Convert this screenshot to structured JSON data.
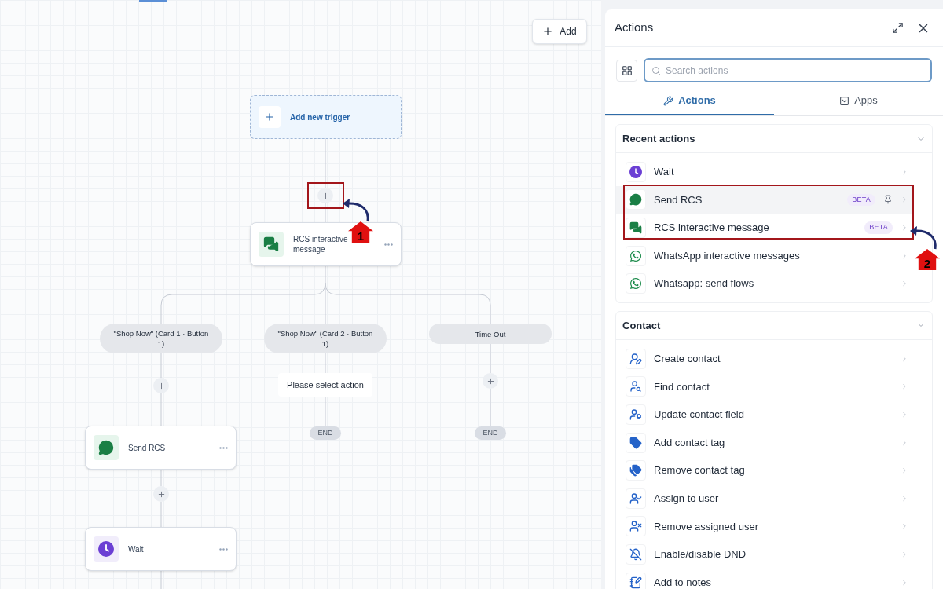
{
  "canvas": {
    "add_button": "Add",
    "trigger": {
      "label": "Add new trigger"
    },
    "main_node": {
      "label": "RCS interactive message",
      "kind": "chats"
    },
    "branches": [
      {
        "label": "\"Shop Now\" (Card 1 · Button 1)",
        "steps": [
          {
            "label": "Send RCS",
            "kind": "chat"
          },
          {
            "label": "Wait",
            "kind": "wait"
          }
        ]
      },
      {
        "label": "\"Shop Now\" (Card 2 · Button 1)",
        "prompt": "Please select action",
        "end": "END"
      },
      {
        "label": "Time Out",
        "end": "END"
      }
    ]
  },
  "panel": {
    "title": "Actions",
    "search": {
      "placeholder": "Search actions"
    },
    "tabs": [
      {
        "label": "Actions",
        "selected": true
      },
      {
        "label": "Apps",
        "selected": false
      }
    ],
    "sections": [
      {
        "title": "Recent actions",
        "items": [
          {
            "label": "Wait",
            "kind": "wait",
            "selected": false
          },
          {
            "label": "Send RCS",
            "kind": "chat",
            "badge": "BETA",
            "selected": true
          },
          {
            "label": "RCS interactive message",
            "kind": "chats",
            "badge": "BETA",
            "selected": false
          },
          {
            "label": "WhatsApp interactive messages",
            "kind": "whatsapp",
            "selected": false
          },
          {
            "label": "Whatsapp: send flows",
            "kind": "whatsapp",
            "selected": false
          }
        ]
      },
      {
        "title": "Contact",
        "items": [
          {
            "label": "Create contact",
            "kind": "user-lines",
            "selected": false
          },
          {
            "label": "Find contact",
            "kind": "user-search",
            "selected": false
          },
          {
            "label": "Update contact field",
            "kind": "user-lines-filled",
            "selected": false
          },
          {
            "label": "Add contact tag",
            "kind": "tag",
            "selected": false
          },
          {
            "label": "Remove contact tag",
            "kind": "tag-remove",
            "selected": false
          },
          {
            "label": "Assign to user",
            "kind": "user-assign",
            "selected": false
          },
          {
            "label": "Remove assigned user",
            "kind": "user-remove",
            "selected": false
          },
          {
            "label": "Enable/disable DND",
            "kind": "bell-off",
            "selected": false
          },
          {
            "label": "Add to notes",
            "kind": "notes",
            "selected": false
          }
        ]
      }
    ]
  },
  "annotations": [
    {
      "label": "1"
    },
    {
      "label": "2"
    }
  ]
}
